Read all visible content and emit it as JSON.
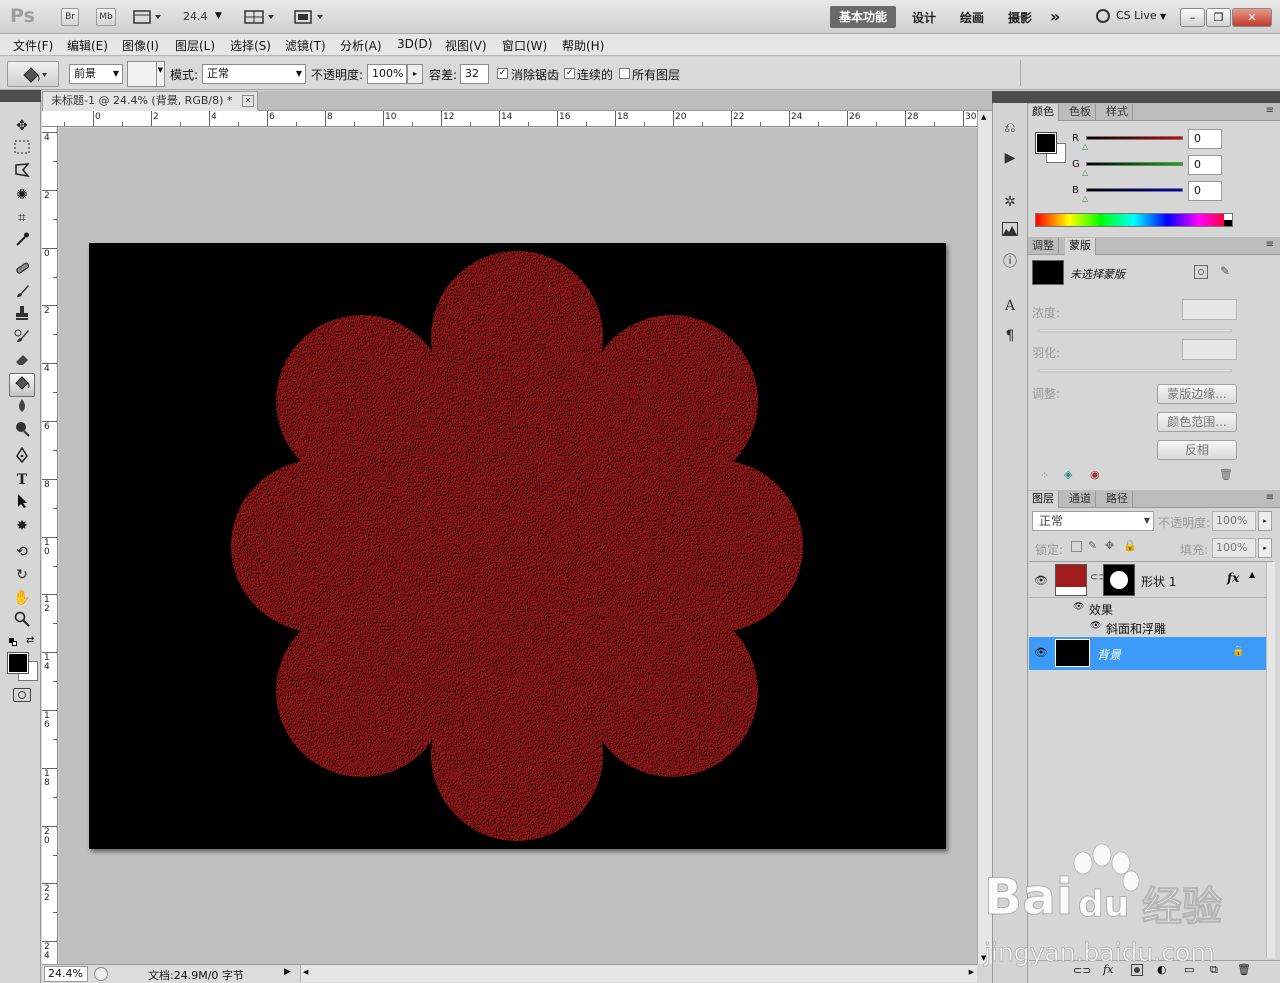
{
  "app": {
    "logo": "Ps",
    "bridge_label": "Br",
    "minibridge_label": "Mb",
    "zoom_value": "24.4",
    "workspaces": [
      "基本功能",
      "设计",
      "绘画",
      "摄影"
    ],
    "workspace_more": "»",
    "cs_live": "CS Live",
    "window_buttons": [
      "–",
      "❐",
      "✕"
    ]
  },
  "menu": [
    "文件(F)",
    "编辑(E)",
    "图像(I)",
    "图层(L)",
    "选择(S)",
    "滤镜(T)",
    "分析(A)",
    "3D(D)",
    "视图(V)",
    "窗口(W)",
    "帮助(H)"
  ],
  "options": {
    "fill_source": "前景",
    "mode_label": "模式:",
    "mode_value": "正常",
    "opacity_label": "不透明度:",
    "opacity_value": "100%",
    "tolerance_label": "容差:",
    "tolerance_value": "32",
    "antialias_label": "消除锯齿",
    "antialias_checked": true,
    "contiguous_label": "连续的",
    "contiguous_checked": true,
    "all_layers_label": "所有图层",
    "all_layers_checked": false
  },
  "document": {
    "tab_title": "未标题-1 @ 24.4% (背景, RGB/8) *",
    "tab_close": "✕",
    "ruler_top_labels": [
      "0",
      "2",
      "4",
      "6",
      "8",
      "10",
      "12",
      "14",
      "16",
      "18",
      "20",
      "22",
      "24",
      "26",
      "28",
      "30"
    ],
    "ruler_left_labels": [
      "4",
      "2",
      "0",
      "2",
      "4",
      "6",
      "8",
      "10",
      "12",
      "14",
      "16",
      "18",
      "20",
      "22",
      "24"
    ],
    "zoom_status": "24.4%",
    "doc_status": "文档:24.9M/0 字节",
    "canvas_background": "#000000",
    "shape_color": "#a01c1c"
  },
  "color_panel": {
    "tabs": [
      "颜色",
      "色板",
      "样式"
    ],
    "active_tab": 0,
    "channels": [
      {
        "label": "R",
        "value": "0",
        "color": "#e00000"
      },
      {
        "label": "G",
        "value": "0",
        "color": "#00c000"
      },
      {
        "label": "B",
        "value": "0",
        "color": "#0000e0"
      }
    ]
  },
  "mask_panel": {
    "tabs": [
      "调整",
      "蒙版"
    ],
    "active_tab": 1,
    "title": "未选择蒙版",
    "density_label": "浓度:",
    "feather_label": "羽化:",
    "adjust_label": "调整:",
    "buttons": [
      "蒙版边缘...",
      "颜色范围...",
      "反相"
    ]
  },
  "layers_panel": {
    "tabs": [
      "图层",
      "通道",
      "路径"
    ],
    "active_tab": 0,
    "blend_mode": "正常",
    "opacity_label": "不透明度:",
    "opacity_value": "100%",
    "lock_label": "锁定:",
    "fill_label": "填充:",
    "fill_value": "100%",
    "layers": [
      {
        "name": "形状 1",
        "fx": "fx",
        "effects_label": "效果",
        "effect": "斜面和浮雕",
        "thumb_color": "#a01c1c"
      },
      {
        "name": "背景",
        "selected": true,
        "thumb_color": "#000000"
      }
    ]
  },
  "watermark": {
    "brand": "Bai",
    "brand2": "du",
    "cn": "经验",
    "url": "jingyan.baidu.com"
  }
}
